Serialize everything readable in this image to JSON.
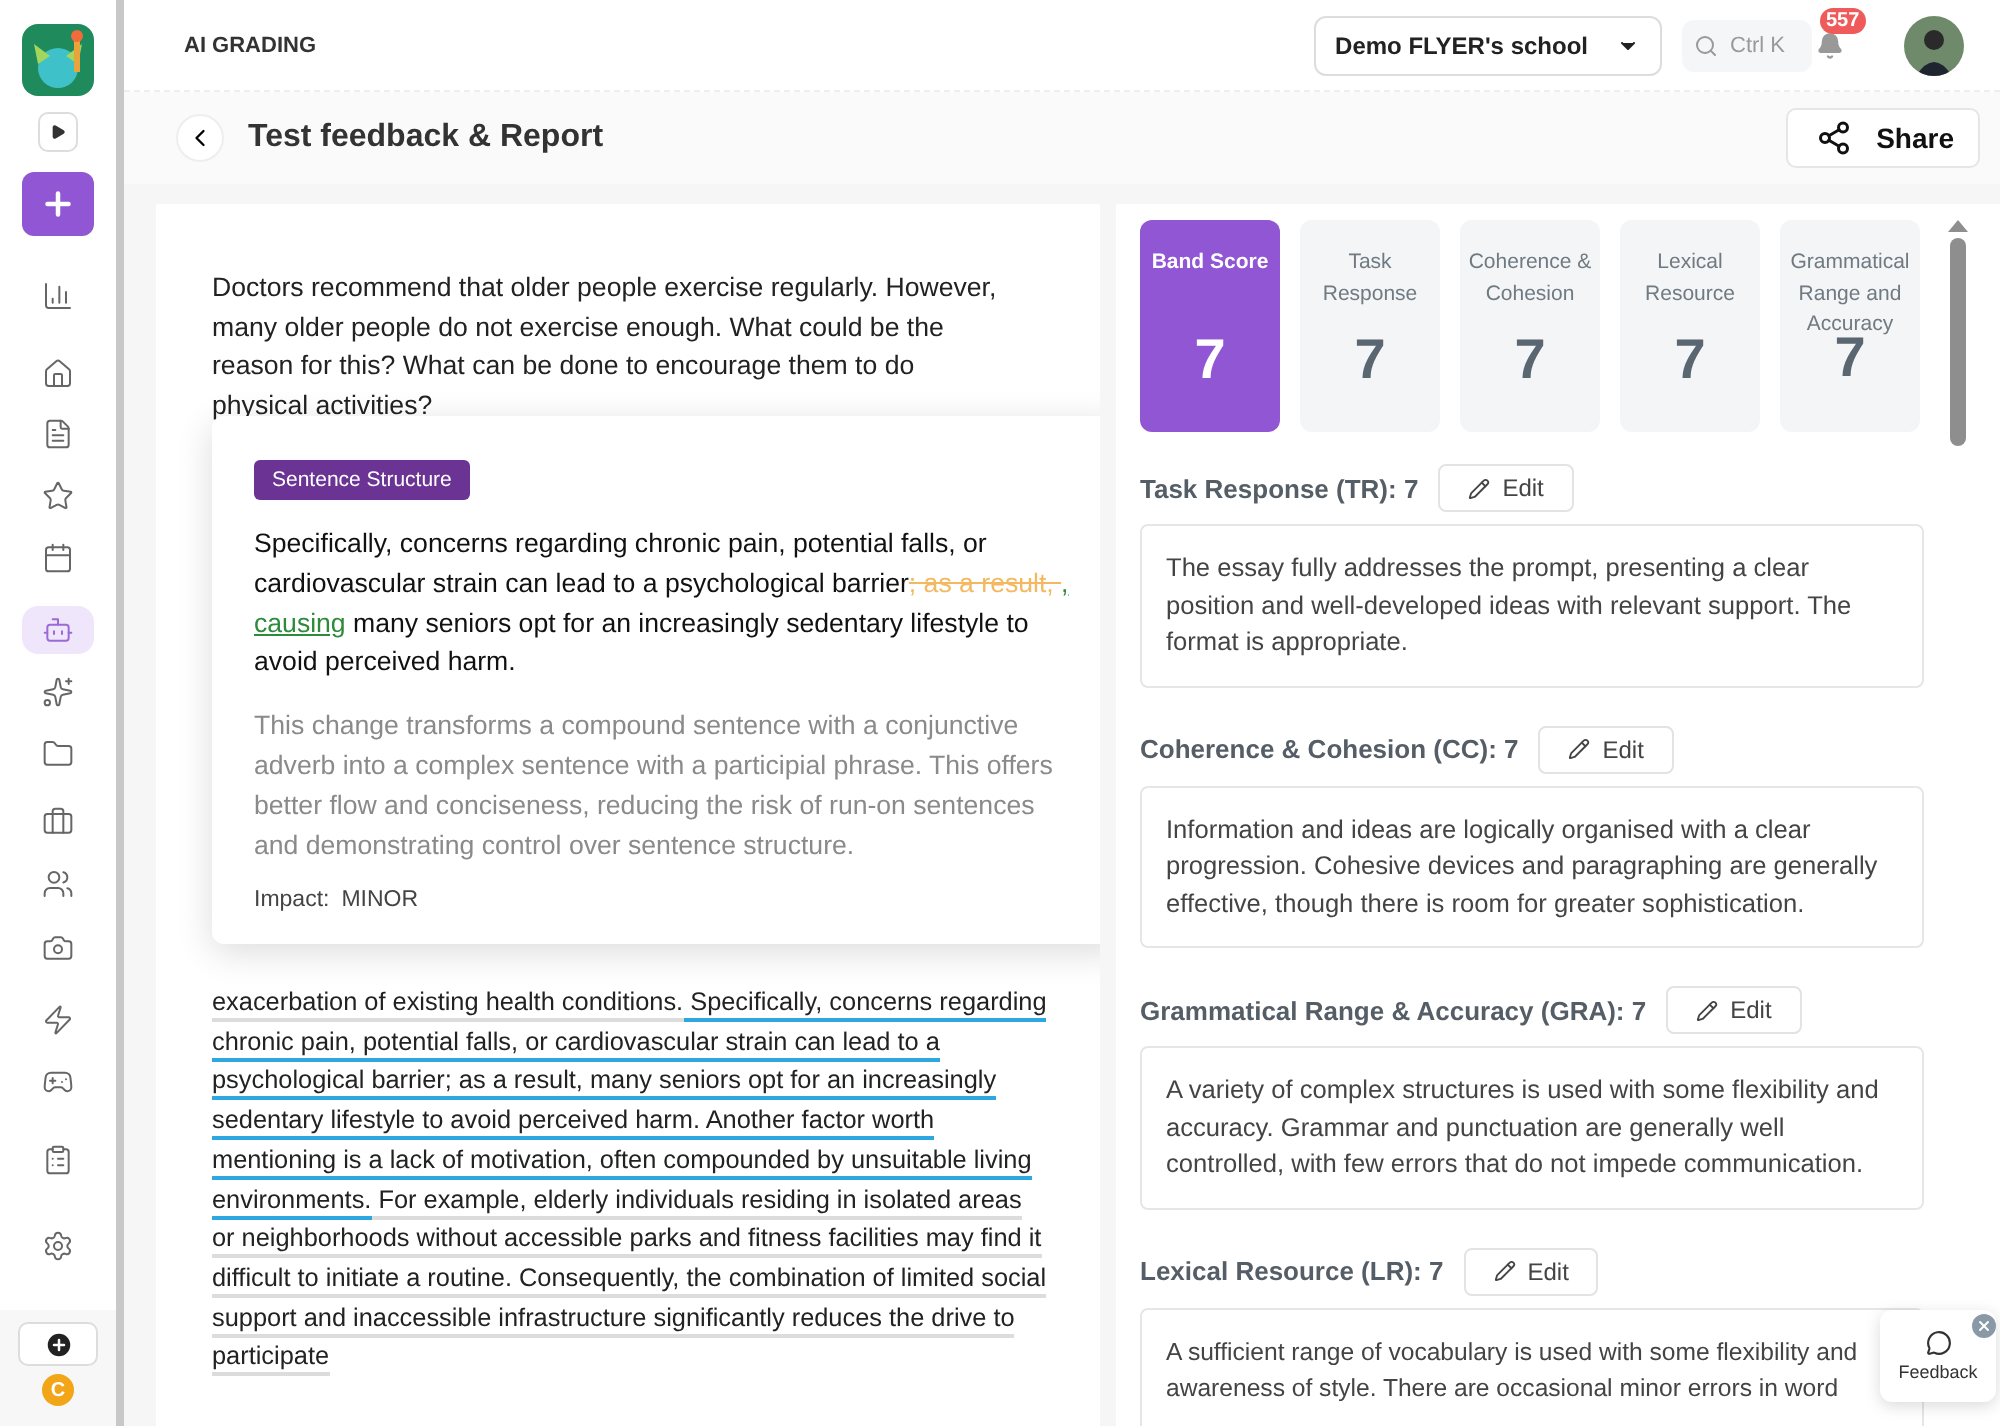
{
  "sidebar": {
    "items": [
      {
        "selected": false
      },
      {
        "selected": false
      },
      {
        "selected": false
      },
      {
        "selected": false
      },
      {
        "selected": false
      },
      {
        "selected": true
      },
      {
        "selected": false
      },
      {
        "selected": false
      },
      {
        "selected": false
      },
      {
        "selected": false
      },
      {
        "selected": false
      },
      {
        "selected": false
      },
      {
        "selected": false
      },
      {
        "selected": false
      },
      {
        "selected": false
      }
    ],
    "coin": "C"
  },
  "header": {
    "section": "AI GRADING",
    "school": "Demo FLYER's school",
    "search": {
      "placeholder": "Ctrl K"
    },
    "notifications": "557"
  },
  "page": {
    "title": "Test feedback & Report",
    "share": "Share"
  },
  "essay": {
    "prompt": "Doctors recommend that older people exercise regularly. However, many older people do not exercise enough. What could be the reason for this? What can be done to encourage them to do physical activities?",
    "segments": [
      {
        "text": "exacerbation of existing health conditions.",
        "flagged": false
      },
      {
        "text": " Specifically, concerns regarding chronic pain, potential falls, or cardiovascular strain can lead to a psychological barrier; as a result, many seniors opt for an increasingly sedentary lifestyle to avoid perceived harm. Another factor worth mentioning is a lack of motivation, often compounded by unsuitable living environments.",
        "flagged": true
      },
      {
        "text": " For example, elderly individuals residing in isolated areas or neighborhoods without accessible parks and fitness facilities may find it difficult to initiate a routine. Consequently, the combination of limited social support and inaccessible infrastructure significantly reduces the drive to participate",
        "flagged": false
      }
    ]
  },
  "popover": {
    "tag": "Sentence Structure",
    "sentence": [
      {
        "text": "Specifically, concerns regarding chronic pain, potential falls, or cardiovascular strain can lead to a psychological barrier",
        "kind": "kept"
      },
      {
        "text": "; as a result, ",
        "kind": "removed"
      },
      {
        "text": ", causing",
        "kind": "added"
      },
      {
        "text": " many seniors opt for an increasingly sedentary lifestyle to avoid perceived harm.",
        "kind": "kept"
      }
    ],
    "explanation": "This change transforms a compound sentence with a conjunctive adverb into a complex sentence with a participial phrase. This offers better flow and conciseness, reducing the risk of run-on sentences and demonstrating control over sentence structure.",
    "impact_label": "Impact:",
    "impact": "MINOR"
  },
  "scores": [
    {
      "label": "Band Score",
      "value": "7",
      "selected": true
    },
    {
      "label": "Task Response",
      "value": "7",
      "selected": false
    },
    {
      "label": "Coherence & Cohesion",
      "value": "7",
      "selected": false
    },
    {
      "label": "Lexical Resource",
      "value": "7",
      "selected": false
    },
    {
      "label": "Grammatical Range and Accuracy",
      "value": "7",
      "selected": false
    }
  ],
  "criteria": [
    {
      "heading": "Task Response (TR): 7",
      "edit": "Edit",
      "text": "The essay fully addresses the prompt, presenting a clear position and well-developed ideas with relevant support. The format is appropriate."
    },
    {
      "heading": "Coherence & Cohesion (CC): 7",
      "edit": "Edit",
      "text": "Information and ideas are logically organised with a clear progression. Cohesive devices and paragraphing are generally effective, though there is room for greater sophistication."
    },
    {
      "heading": "Grammatical Range & Accuracy (GRA): 7",
      "edit": "Edit",
      "text": "A variety of complex structures is used with some flexibility and accuracy. Grammar and punctuation are generally well controlled, with few errors that do not impede communication."
    },
    {
      "heading": "Lexical Resource (LR): 7",
      "edit": "Edit",
      "text": "A sufficient range of vocabulary is used with some flexibility and awareness of style. There are occasional minor errors in word"
    }
  ],
  "feedback": "Feedback"
}
